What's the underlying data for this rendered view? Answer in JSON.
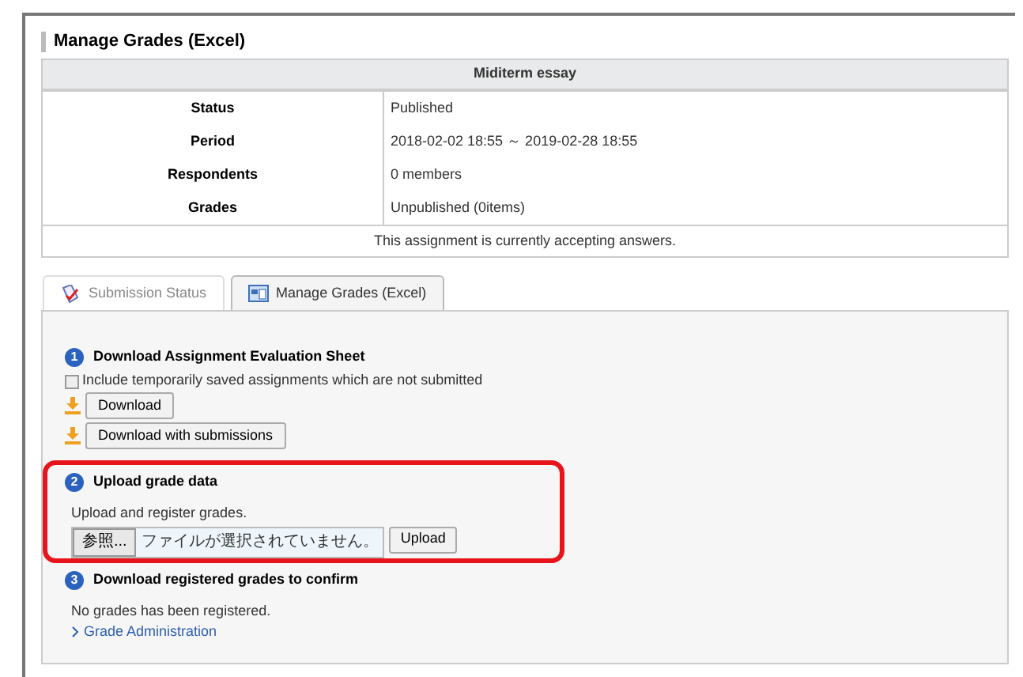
{
  "page_title": "Manage Grades (Excel)",
  "assignment": {
    "title": "Miditerm essay",
    "rows": [
      {
        "label": "Status",
        "value": "Published"
      },
      {
        "label": "Period",
        "value": "2018-02-02 18:55 ～ 2019-02-28 18:55"
      },
      {
        "label": "Respondents",
        "value": "0 members"
      },
      {
        "label": "Grades",
        "value": "Unpublished (0items)"
      }
    ],
    "note": "This assignment is currently accepting answers."
  },
  "tabs": [
    {
      "label": "Submission Status",
      "selected": false
    },
    {
      "label": "Manage Grades (Excel)",
      "selected": true
    }
  ],
  "steps": [
    {
      "number": "1",
      "title": "Download Assignment Evaluation Sheet",
      "highlighted": false,
      "checkbox": {
        "label": "Include temporarily saved assignments which are not submitted",
        "checked": false
      },
      "buttons": [
        "Download",
        "Download with submissions"
      ]
    },
    {
      "number": "2",
      "title": "Upload grade data",
      "highlighted": true,
      "text": "Upload and register grades.",
      "file": {
        "browse": "参照...",
        "status": "ファイルが選択されていません。",
        "upload": "Upload"
      }
    },
    {
      "number": "3",
      "title": "Download registered grades to confirm",
      "highlighted": false,
      "text": "No grades has been registered.",
      "link": "Grade Administration"
    }
  ]
}
